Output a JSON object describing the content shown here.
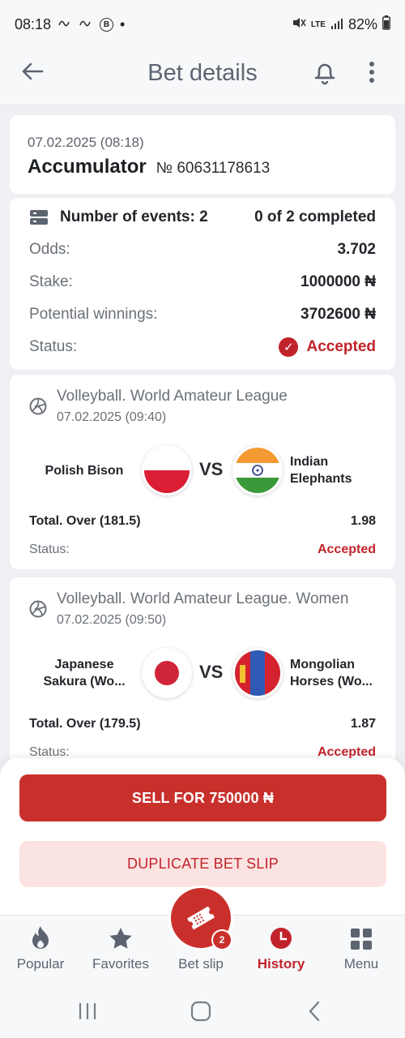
{
  "status_bar": {
    "time": "08:18",
    "notif_icons": [
      "wave-icon",
      "wave-icon",
      "b-icon"
    ],
    "notif_b": "B",
    "dot": "•",
    "lte": "LTE",
    "battery": "82%"
  },
  "header": {
    "title": "Bet details"
  },
  "bet": {
    "date": "07.02.2025 (08:18)",
    "type": "Accumulator",
    "number": "№ 60631178613"
  },
  "summary": {
    "events_label": "Number of events: 2",
    "completed": "0 of 2 completed",
    "odds_label": "Odds:",
    "odds_value": "3.702",
    "stake_label": "Stake:",
    "stake_value": "1000000 ₦",
    "winnings_label": "Potential winnings:",
    "winnings_value": "3702600 ₦",
    "status_label": "Status:",
    "status_value": "Accepted"
  },
  "events": [
    {
      "league": "Volleyball. World Amateur League",
      "date": "07.02.2025 (09:40)",
      "team1": "Polish Bison",
      "team2_line1": "Indian",
      "team2_line2": "Elephants",
      "vs": "VS",
      "bet": "Total. Over (181.5)",
      "odds": "1.98",
      "status_label": "Status:",
      "status_value": "Accepted"
    },
    {
      "league": "Volleyball. World Amateur League. Women",
      "date": "07.02.2025 (09:50)",
      "team1_line1": "Japanese",
      "team1_line2": "Sakura (Wo...",
      "team2_line1": "Mongolian",
      "team2_line2": "Horses (Wo...",
      "vs": "VS",
      "bet": "Total. Over (179.5)",
      "odds": "1.87",
      "status_label": "Status:",
      "status_value": "Accepted"
    }
  ],
  "actions": {
    "sell": "SELL FOR 750000 ₦",
    "duplicate": "DUPLICATE BET SLIP"
  },
  "nav": {
    "popular": "Popular",
    "favorites": "Favorites",
    "betslip": "Bet slip",
    "betslip_badge": "2",
    "history": "History",
    "menu": "Menu"
  },
  "colors": {
    "accent": "#c9302c",
    "status_accepted": "#c2232b",
    "background": "#eef0f3"
  }
}
